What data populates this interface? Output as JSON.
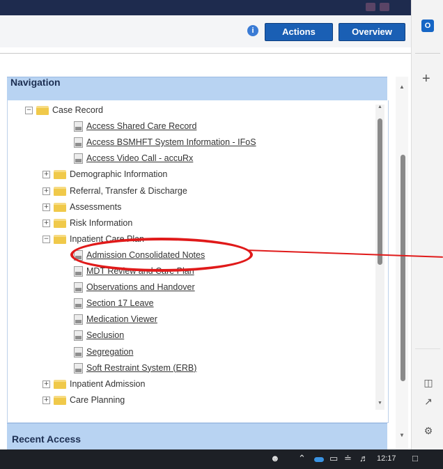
{
  "header": {
    "info_icon": "info-icon",
    "actions_label": "Actions",
    "overview_label": "Overview"
  },
  "navigation": {
    "title": "Navigation",
    "items": [
      {
        "label": "Case Record",
        "type": "folder",
        "level": 0,
        "expanded": true
      },
      {
        "label": "Access Shared Care Record",
        "type": "link",
        "level": 1
      },
      {
        "label": "Access BSMHFT System Information - IFoS",
        "type": "link",
        "level": 1
      },
      {
        "label": "Access Video Call - accuRx",
        "type": "link",
        "level": 1
      },
      {
        "label": "Demographic Information",
        "type": "folder",
        "level": 1,
        "expanded": false
      },
      {
        "label": "Referral, Transfer & Discharge",
        "type": "folder",
        "level": 1,
        "expanded": false
      },
      {
        "label": "Assessments",
        "type": "folder",
        "level": 1,
        "expanded": false
      },
      {
        "label": "Risk Information",
        "type": "folder",
        "level": 1,
        "expanded": false
      },
      {
        "label": "Inpatient Care Plan",
        "type": "folder",
        "level": 1,
        "expanded": true
      },
      {
        "label": "Admission Consolidated Notes",
        "type": "link",
        "level": 2,
        "highlighted": true
      },
      {
        "label": "MDT Review and Care Plan",
        "type": "link",
        "level": 2
      },
      {
        "label": "Observations and Handover",
        "type": "link",
        "level": 2
      },
      {
        "label": "Section 17 Leave",
        "type": "link",
        "level": 2
      },
      {
        "label": "Medication Viewer",
        "type": "link",
        "level": 2
      },
      {
        "label": "Seclusion",
        "type": "link",
        "level": 2
      },
      {
        "label": "Segregation",
        "type": "link",
        "level": 2
      },
      {
        "label": "Soft Restraint System (ERB)",
        "type": "link",
        "level": 2
      },
      {
        "label": "Inpatient Admission",
        "type": "folder",
        "level": 1,
        "expanded": false
      },
      {
        "label": "Care Planning",
        "type": "folder",
        "level": 1,
        "expanded": false
      }
    ]
  },
  "recent_access": {
    "title": "Recent Access"
  },
  "taskbar": {
    "time": "12:17"
  },
  "colors": {
    "accent": "#1a5fb4",
    "panel_header": "#b8d3f2",
    "annotation": "#e01a1a"
  }
}
